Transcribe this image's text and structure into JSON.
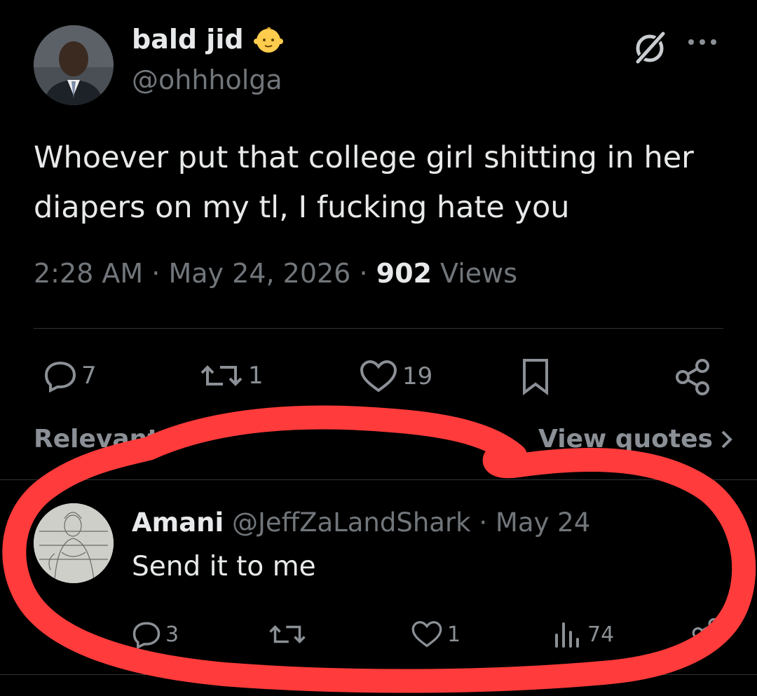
{
  "tweet": {
    "author_name": "bald jid",
    "author_handle": "@ohhholga",
    "text": "Whoever put that college girl shitting in her diapers on my tl, I fucking hate you",
    "time": "2:28 AM",
    "sep1": "·",
    "date": "May 24, 2026",
    "sep2": "·",
    "views_count": "902",
    "views_label": "Views",
    "actions": {
      "replies": "7",
      "reposts": "1",
      "likes": "19"
    },
    "icons": {
      "verified_emoji": "baby-face-icon",
      "grok": "grok-icon",
      "more": "more-icon",
      "reply": "reply-icon",
      "repost": "repost-icon",
      "like": "heart-icon",
      "bookmark": "bookmark-icon",
      "share": "share-icon"
    }
  },
  "replies_header": {
    "sort_label": "Relevant",
    "view_quotes_label": "View quotes"
  },
  "reply": {
    "author_name": "Amani",
    "author_handle": "@JeffZaLandShark",
    "sep": "·",
    "date": "May 24",
    "text": "Send it to me",
    "actions": {
      "replies": "3",
      "likes": "1",
      "views": "74"
    }
  },
  "colors": {
    "background": "#000000",
    "text_primary": "#e7e9ea",
    "text_secondary": "#71767b",
    "annotation_circle": "#ff3b3b"
  }
}
